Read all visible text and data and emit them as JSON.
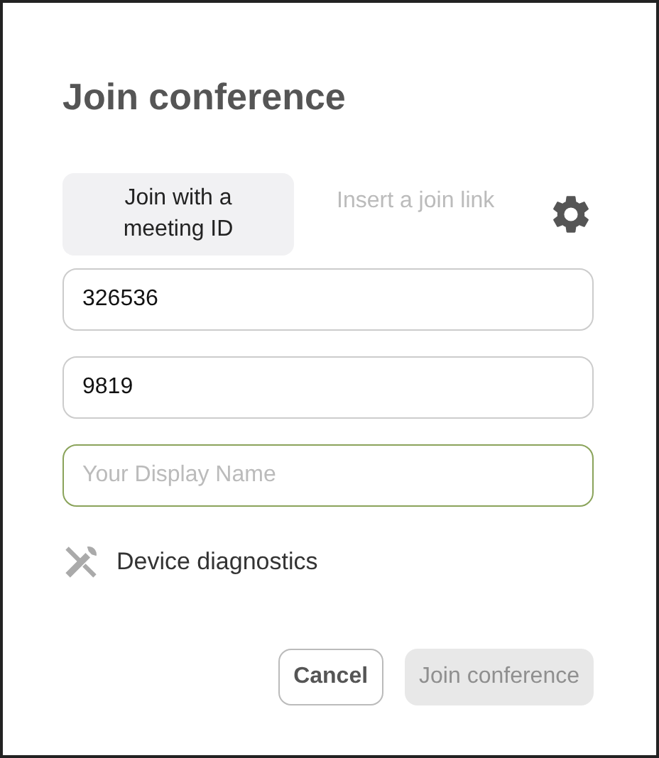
{
  "dialog": {
    "title": "Join conference"
  },
  "tabs": [
    {
      "label": "Join with a meeting ID",
      "selected": true
    },
    {
      "label": "Insert a join link",
      "selected": false
    }
  ],
  "fields": [
    {
      "value": "326536",
      "focused": false
    },
    {
      "value": "9819",
      "focused": false
    },
    {
      "placeholder": "Your Display Name",
      "focused": true
    }
  ],
  "diagnostics": {
    "label": "Device diagnostics"
  },
  "buttons": [
    {
      "label": "Cancel",
      "kind": "secondary",
      "disabled": false
    },
    {
      "label": "Join conference",
      "kind": "primary",
      "disabled": true
    }
  ]
}
